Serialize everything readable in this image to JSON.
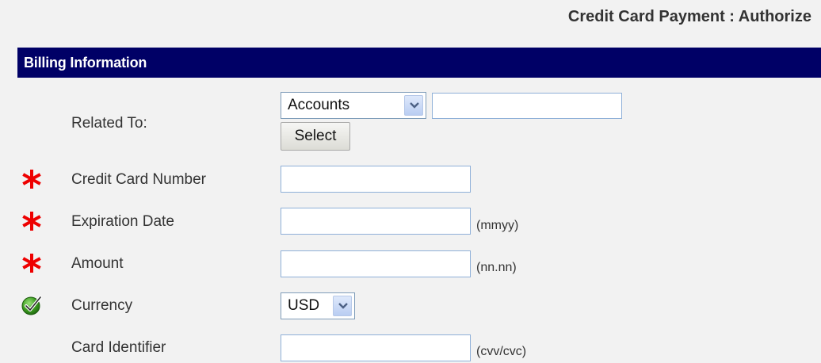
{
  "header": {
    "title": "Credit Card Payment : Authorize"
  },
  "section": {
    "title": "Billing Information"
  },
  "form": {
    "related_to": {
      "label": "Related To:",
      "type_selected": "Accounts",
      "value": "",
      "select_button": "Select"
    },
    "card_number": {
      "label": "Credit Card Number",
      "value": "",
      "required": true
    },
    "expiration": {
      "label": "Expiration Date",
      "value": "",
      "hint": "(mmyy)",
      "required": true
    },
    "amount": {
      "label": "Amount",
      "value": "",
      "hint": "(nn.nn)",
      "required": true
    },
    "currency": {
      "label": "Currency",
      "selected": "USD",
      "status_icon": "green-check-icon"
    },
    "card_identifier": {
      "label": "Card Identifier",
      "value": "",
      "hint": "(cvv/cvc)"
    }
  },
  "icons": {
    "required": "red-asterisk-icon",
    "dropdown": "chevron-down-icon"
  },
  "colors": {
    "header_bg": "#000066",
    "header_text": "#ffffff",
    "page_bg": "#f2f2f2",
    "required_icon": "#ee0000",
    "check_icon": "#3a9a1e",
    "input_border": "#8fb0d8"
  }
}
